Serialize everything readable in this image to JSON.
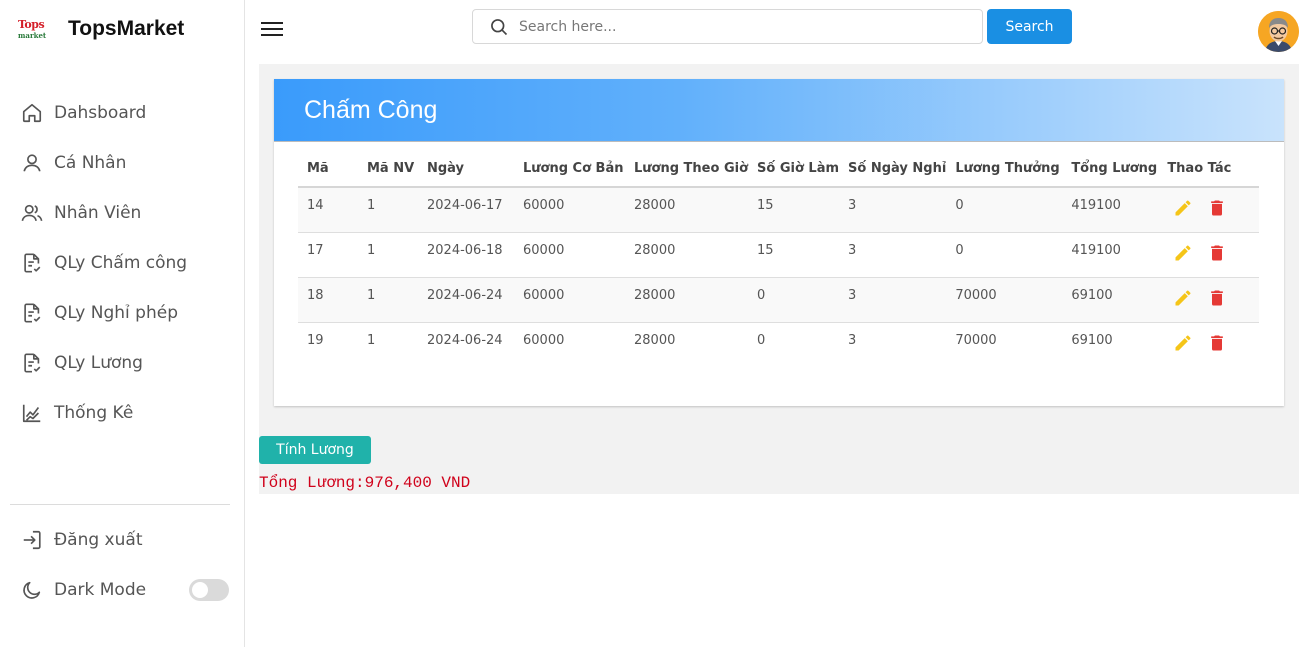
{
  "brand": {
    "logo_line1": "Tops",
    "logo_line2": "market",
    "name": "TopsMarket"
  },
  "sidebar": {
    "items": [
      {
        "label": "Dahsboard",
        "icon": "home-icon"
      },
      {
        "label": "Cá Nhân",
        "icon": "user-icon"
      },
      {
        "label": "Nhân Viên",
        "icon": "users-icon"
      },
      {
        "label": "QLy Chấm công",
        "icon": "document-check-icon"
      },
      {
        "label": "QLy Nghỉ phép",
        "icon": "document-check-icon"
      },
      {
        "label": "QLy Lương",
        "icon": "document-check-icon"
      },
      {
        "label": "Thống Kê",
        "icon": "chart-icon"
      }
    ],
    "logout": "Đăng xuất",
    "dark_mode": "Dark Mode",
    "dark_mode_on": false
  },
  "topbar": {
    "search_placeholder": "Search here...",
    "search_button": "Search"
  },
  "card": {
    "title": "Chấm Công"
  },
  "table": {
    "headers": [
      "Mã",
      "Mã NV",
      "Ngày",
      "Lương Cơ Bản",
      "Lương Theo Giờ",
      "Số Giờ Làm",
      "Số Ngày Nghỉ",
      "Lương Thưởng",
      "Tổng Lương",
      "Thao Tác"
    ],
    "rows": [
      [
        "14",
        "1",
        "2024-06-17",
        "60000",
        "28000",
        "15",
        "3",
        "0",
        "419100"
      ],
      [
        "17",
        "1",
        "2024-06-18",
        "60000",
        "28000",
        "15",
        "3",
        "0",
        "419100"
      ],
      [
        "18",
        "1",
        "2024-06-24",
        "60000",
        "28000",
        "0",
        "3",
        "70000",
        "69100"
      ],
      [
        "19",
        "1",
        "2024-06-24",
        "60000",
        "28000",
        "0",
        "3",
        "70000",
        "69100"
      ]
    ]
  },
  "actions": {
    "calc_button": "Tính Lương",
    "total_text": "Tổng Lương:976,400 VND"
  },
  "colors": {
    "accent": "#1a8fe3",
    "teal": "#20b2aa",
    "edit": "#f5c518",
    "delete": "#e53935",
    "total": "#d0021b"
  }
}
